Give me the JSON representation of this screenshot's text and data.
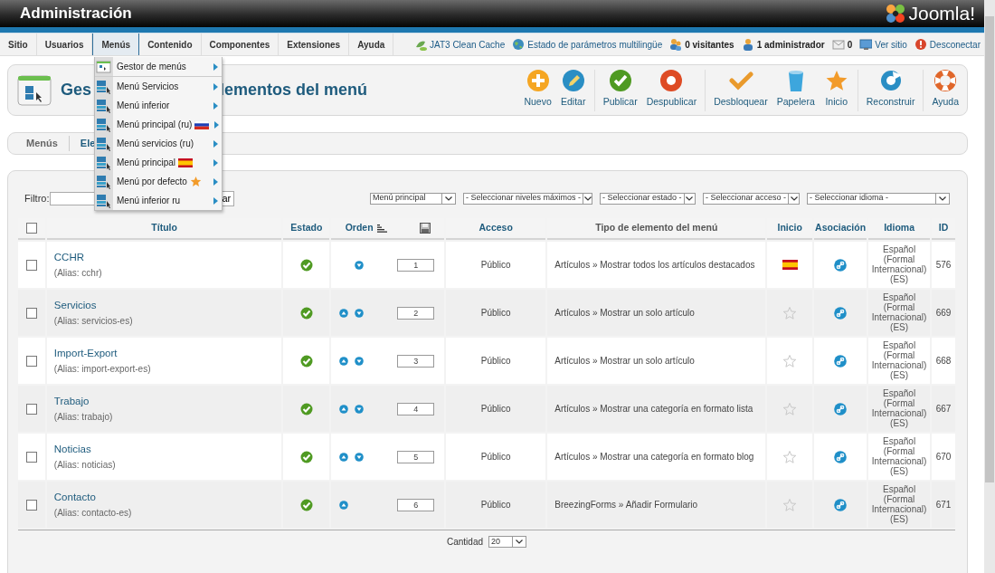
{
  "header": {
    "title": "Administración",
    "logo_text": "Joomla!"
  },
  "menu": {
    "tabs": [
      {
        "label": "Sitio",
        "selected": false
      },
      {
        "label": "Usuarios",
        "selected": false
      },
      {
        "label": "Menús",
        "selected": true
      },
      {
        "label": "Contenido",
        "selected": false
      },
      {
        "label": "Componentes",
        "selected": false
      },
      {
        "label": "Extensiones",
        "selected": false
      },
      {
        "label": "Ayuda",
        "selected": false
      }
    ],
    "status": [
      {
        "kind": "cache",
        "label": "JAT3 Clean Cache",
        "link": true
      },
      {
        "kind": "globe",
        "label": "Estado de parámetros multilingüe",
        "link": true
      },
      {
        "kind": "users",
        "label": "0 visitantes",
        "link": false
      },
      {
        "kind": "admin",
        "label": "1 administrador",
        "link": false
      },
      {
        "kind": "mail",
        "label": "0",
        "link": false
      },
      {
        "kind": "screen",
        "label": "Ver sitio",
        "link": true
      },
      {
        "kind": "power",
        "label": "Desconectar",
        "link": true
      }
    ]
  },
  "dropdown": {
    "items": [
      {
        "kind": "manager",
        "label": "Gestor de menús"
      },
      {
        "kind": "menu",
        "label": "Menú Servicios"
      },
      {
        "kind": "menu",
        "label": "Menú inferior"
      },
      {
        "kind": "menu-flag-ru",
        "label": "Menú principal (ru)"
      },
      {
        "kind": "menu",
        "label": "Menú servicios (ru)"
      },
      {
        "kind": "menu-flag-es",
        "label": "Menú principal"
      },
      {
        "kind": "menu-default",
        "label": "Menú por defecto"
      },
      {
        "kind": "menu",
        "label": "Menú inferior ru"
      }
    ]
  },
  "page_title_parts": [
    "Ges",
    "lementos del menú"
  ],
  "toolbar": {
    "groups": [
      [
        {
          "kind": "new",
          "label": "Nuevo"
        },
        {
          "kind": "edit",
          "label": "Editar"
        }
      ],
      [
        {
          "kind": "publish",
          "label": "Publicar"
        },
        {
          "kind": "unpublish",
          "label": "Despublicar"
        }
      ],
      [
        {
          "kind": "checkin",
          "label": "Desbloquear"
        },
        {
          "kind": "trash",
          "label": "Papelera"
        },
        {
          "kind": "home",
          "label": "Inicio"
        }
      ],
      [
        {
          "kind": "rebuild",
          "label": "Reconstruir"
        }
      ],
      [
        {
          "kind": "help",
          "label": "Ayuda"
        }
      ]
    ]
  },
  "subnav": [
    {
      "label": "Menús",
      "selected": false
    },
    {
      "label": "Ele",
      "selected": true
    }
  ],
  "filter": {
    "label": "Filtro:",
    "button": "ar",
    "selects": [
      "Menú principal",
      "- Seleccionar niveles máximos -",
      "- Seleccionar estado -",
      "- Seleccionar acceso -",
      "- Seleccionar idioma -"
    ]
  },
  "table": {
    "select_all_checked": false,
    "columns": [
      {
        "kind": "title",
        "label": "Título",
        "sortable": true
      },
      {
        "kind": "text",
        "label": "Estado",
        "sortable": true
      },
      {
        "kind": "order",
        "label": "Orden",
        "sortable": true
      },
      {
        "kind": "text",
        "label": "Acceso",
        "sortable": true
      },
      {
        "kind": "text",
        "label": "Tipo de elemento del menú",
        "sortable": false
      },
      {
        "kind": "text",
        "label": "Inicio",
        "sortable": true
      },
      {
        "kind": "text",
        "label": "Asociación",
        "sortable": true
      },
      {
        "kind": "text",
        "label": "Idioma",
        "sortable": true
      },
      {
        "kind": "text",
        "label": "ID",
        "sortable": true
      }
    ],
    "rows": [
      {
        "checked": false,
        "title": "CCHR",
        "alias": "(Alias: cchr)",
        "published": true,
        "can_move_up": false,
        "can_move_down": true,
        "order": "1",
        "access": "Público",
        "type": "Artículos » Mostrar todos los artículos destacados",
        "home": true,
        "language": "Español (Formal Internacional) (ES)",
        "id": "576"
      },
      {
        "checked": false,
        "title": "Servicios",
        "alias": "(Alias: servicios-es)",
        "published": true,
        "can_move_up": true,
        "can_move_down": true,
        "order": "2",
        "access": "Público",
        "type": "Artículos » Mostrar un solo artículo",
        "home": false,
        "language": "Español (Formal Internacional) (ES)",
        "id": "669"
      },
      {
        "checked": false,
        "title": "Import-Export",
        "alias": "(Alias: import-export-es)",
        "published": true,
        "can_move_up": true,
        "can_move_down": true,
        "order": "3",
        "access": "Público",
        "type": "Artículos » Mostrar un solo artículo",
        "home": false,
        "language": "Español (Formal Internacional) (ES)",
        "id": "668"
      },
      {
        "checked": false,
        "title": "Trabajo",
        "alias": "(Alias: trabajo)",
        "published": true,
        "can_move_up": true,
        "can_move_down": true,
        "order": "4",
        "access": "Público",
        "type": "Artículos » Mostrar una categoría en formato lista",
        "home": false,
        "language": "Español (Formal Internacional) (ES)",
        "id": "667"
      },
      {
        "checked": false,
        "title": "Noticias",
        "alias": "(Alias: noticias)",
        "published": true,
        "can_move_up": true,
        "can_move_down": true,
        "order": "5",
        "access": "Público",
        "type": "Artículos » Mostrar una categoría en formato blog",
        "home": false,
        "language": "Español (Formal Internacional) (ES)",
        "id": "670"
      },
      {
        "checked": false,
        "title": "Contacto",
        "alias": "(Alias: contacto-es)",
        "published": true,
        "can_move_up": true,
        "can_move_down": false,
        "order": "6",
        "access": "Público",
        "type": "BreezingForms » Añadir Formulario",
        "home": false,
        "language": "Español (Formal Internacional) (ES)",
        "id": "671"
      }
    ]
  },
  "footer": {
    "label": "Cantidad",
    "value": "20"
  }
}
